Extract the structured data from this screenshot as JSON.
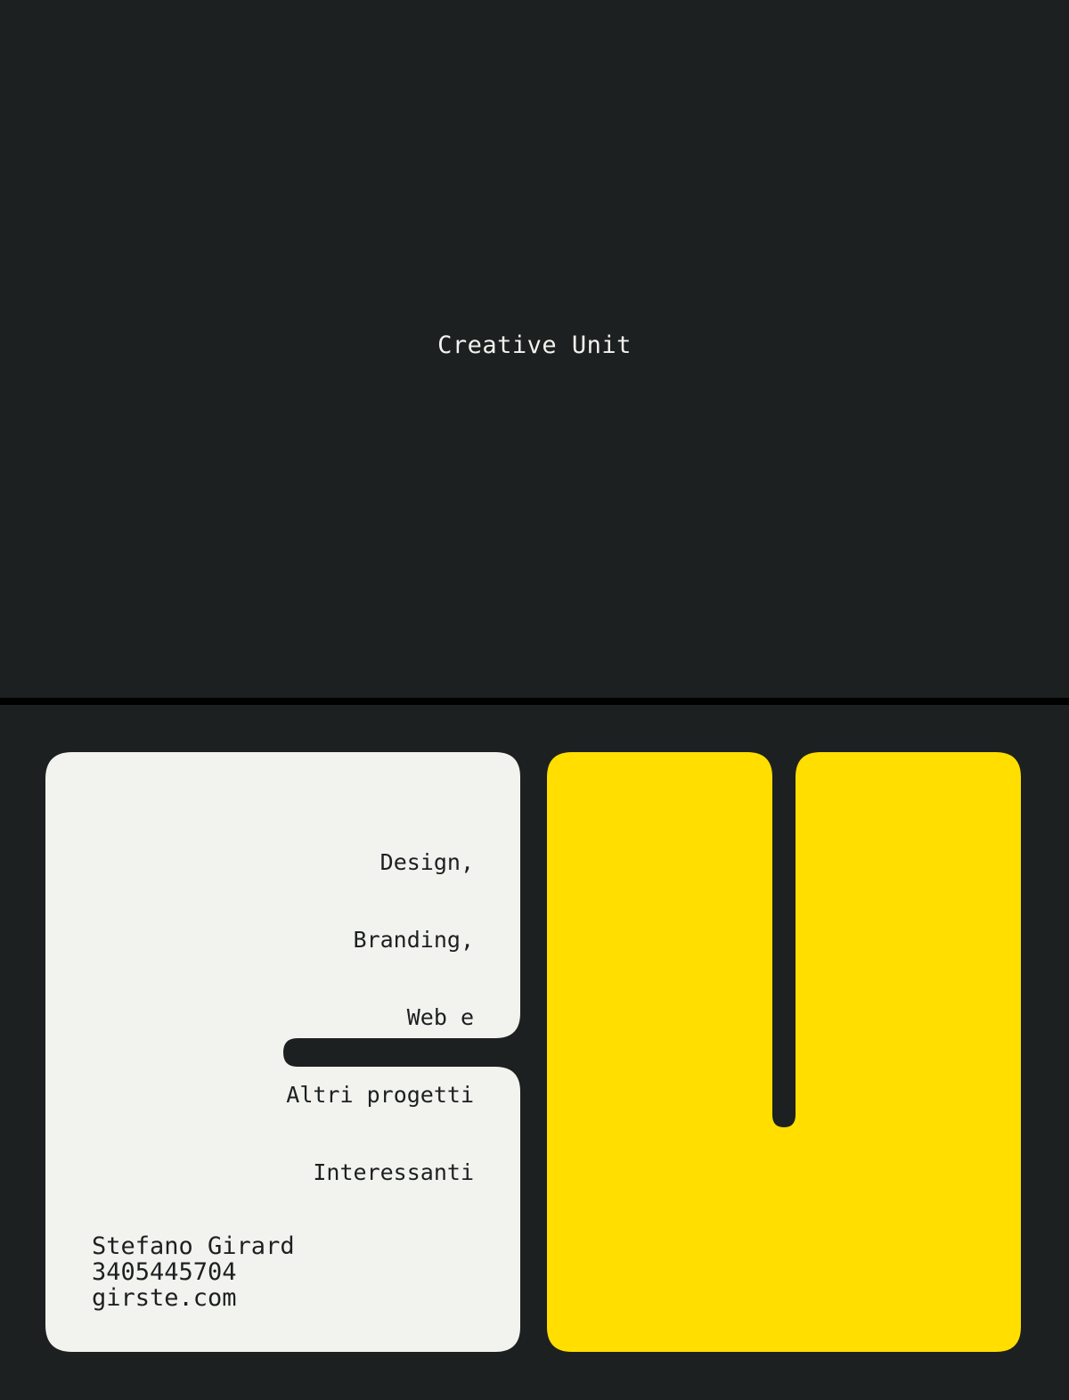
{
  "top": {
    "brand_name": "Creative Unit"
  },
  "card": {
    "services": [
      "Design,",
      "Branding,",
      "Web e",
      "Altri progetti",
      "Interessanti"
    ],
    "contact": {
      "name": "Stefano Girard",
      "phone": "3405445704",
      "website": "girste.com"
    }
  },
  "colors": {
    "background": "#1d2020",
    "divider": "#000000",
    "card_light": "#f2f3ef",
    "card_yellow": "#ffde00",
    "text_dark": "#1d2020",
    "text_light": "#f2f3ef"
  }
}
